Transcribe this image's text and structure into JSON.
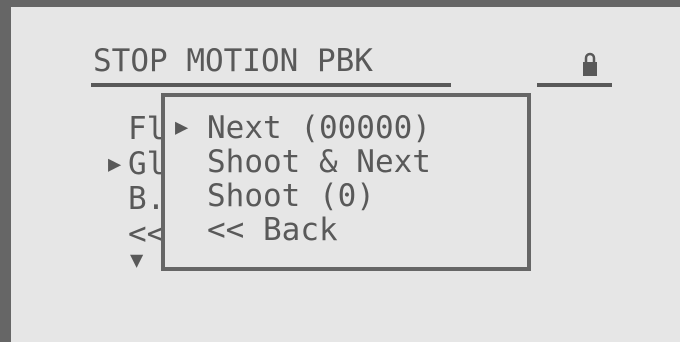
{
  "header": {
    "title": "STOP MOTION PBK",
    "lock_icon": "lock-icon"
  },
  "background_menu": {
    "items": [
      {
        "label": "Fl",
        "selected": false
      },
      {
        "label": "Gl",
        "selected": true
      },
      {
        "label": "B.",
        "selected": false
      },
      {
        "label": "<<",
        "selected": false
      }
    ],
    "cursor_glyph": "▶",
    "more_indicator": "▼"
  },
  "popup_menu": {
    "cursor_glyph": "▶",
    "items": [
      {
        "label": "Next (00000)",
        "selected": true
      },
      {
        "label": "Shoot & Next",
        "selected": false
      },
      {
        "label": "Shoot (0)",
        "selected": false
      },
      {
        "label": "<< Back",
        "selected": false
      }
    ]
  },
  "colors": {
    "background": "#e6e6e6",
    "foreground": "#595959",
    "frame": "#666666"
  }
}
